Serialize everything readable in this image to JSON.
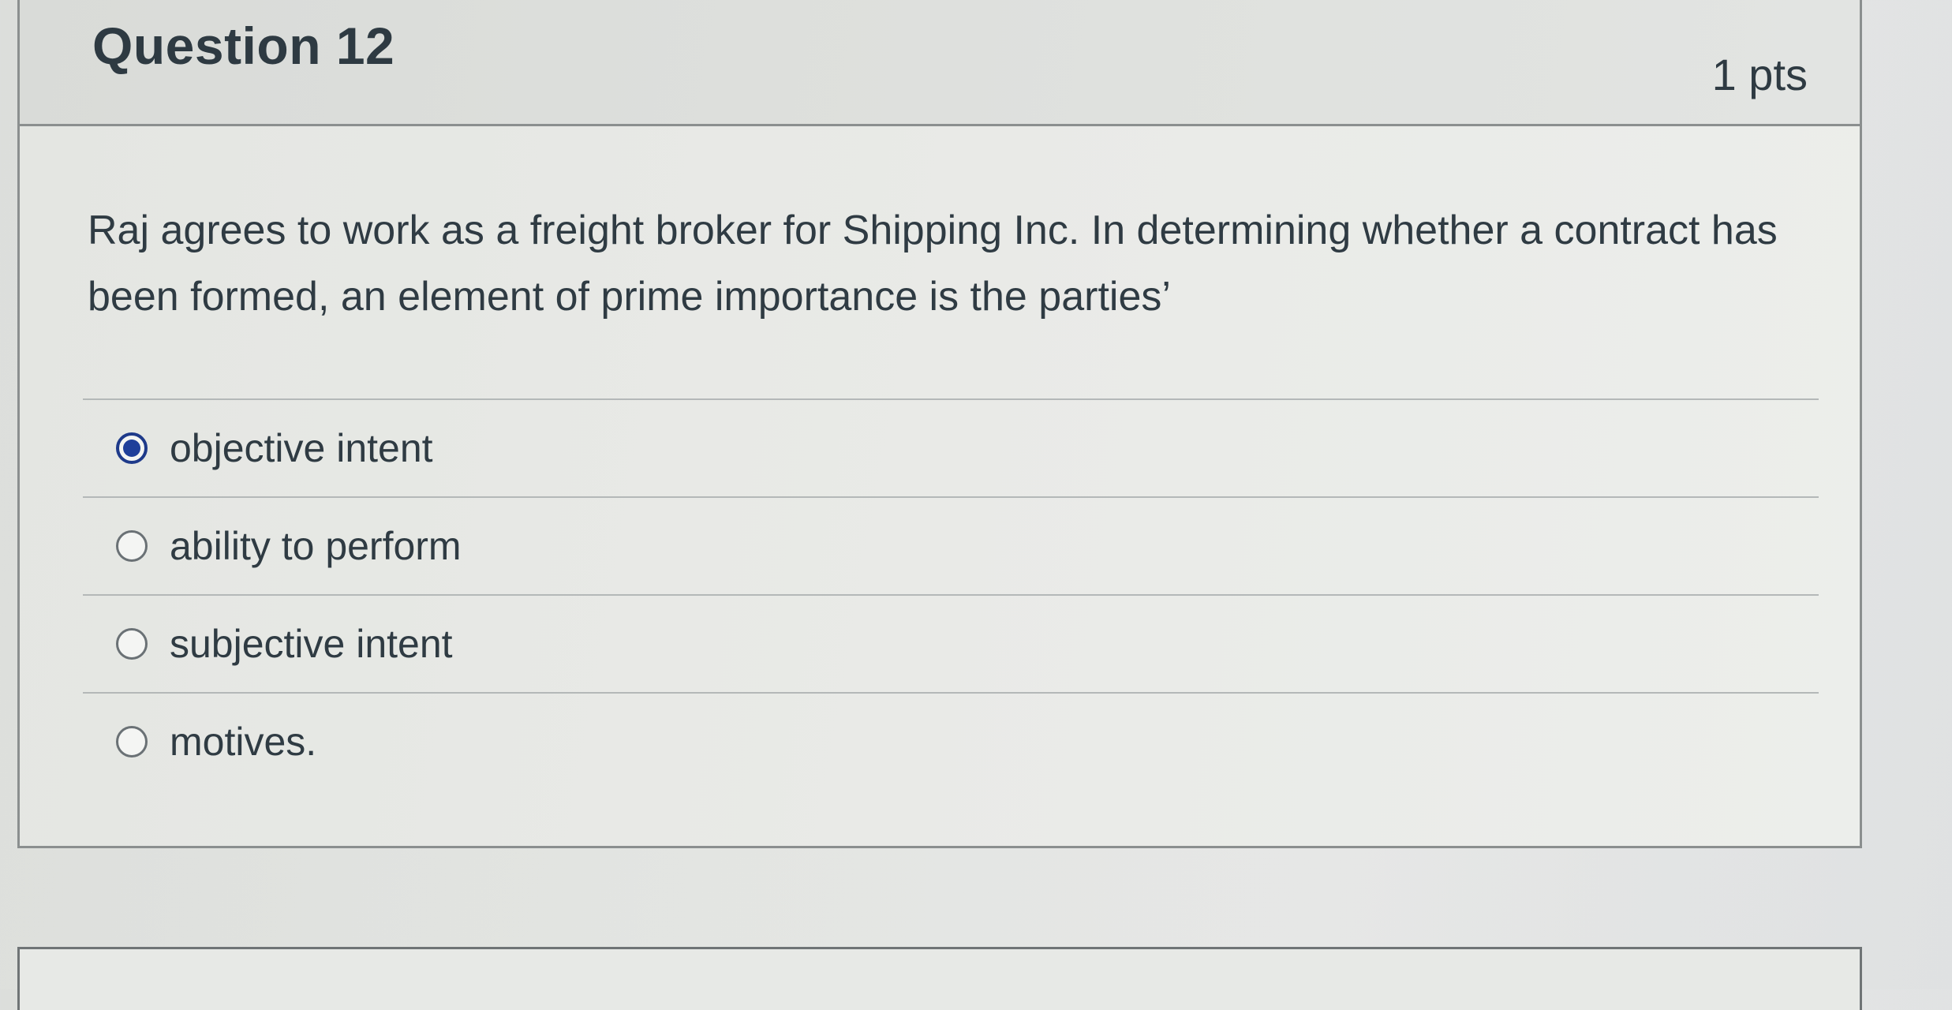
{
  "question": {
    "title": "Question 12",
    "points": "1 pts",
    "text": "Raj agrees to work as a freight broker for Shipping Inc. In determining whether a contract has been formed, an element of prime importance is the parties’",
    "answers": [
      {
        "label": "objective intent",
        "selected": true
      },
      {
        "label": "ability to perform",
        "selected": false
      },
      {
        "label": "subjective intent",
        "selected": false
      },
      {
        "label": "motives.",
        "selected": false
      }
    ]
  },
  "colors": {
    "selected_radio": "#1f3f9a",
    "text": "#2f3b43",
    "border": "#8b8f8f"
  }
}
